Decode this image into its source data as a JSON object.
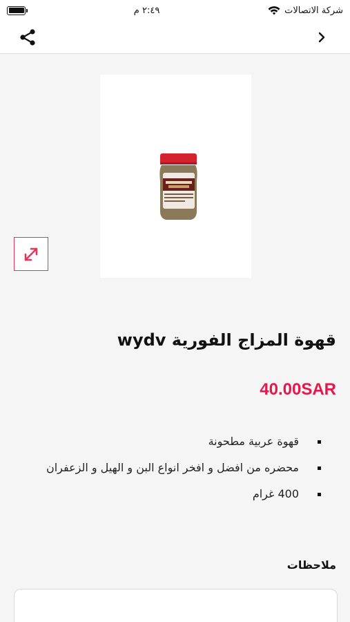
{
  "status_bar": {
    "carrier": "شركة الاتصالات",
    "time": "٢:٤٩ م",
    "wifi_icon": "wifi-icon",
    "battery_icon": "battery-icon"
  },
  "nav": {
    "share_icon": "share-icon",
    "back_icon": "chevron-right-icon"
  },
  "product": {
    "image_icon": "coffee-jar-image",
    "expand_icon": "expand-icon",
    "title": "قهوة المزاج الفورية wydv",
    "price": "40.00SAR",
    "description": [
      "قهوة عربية مطحونة",
      "محضره من افضل و افخر انواع البن و الهيل و الزعفران",
      "400 غرام"
    ]
  },
  "notes": {
    "label": "ملاحظات",
    "value": ""
  },
  "colors": {
    "accent": "#e3194b",
    "background": "#f5f5f5"
  }
}
